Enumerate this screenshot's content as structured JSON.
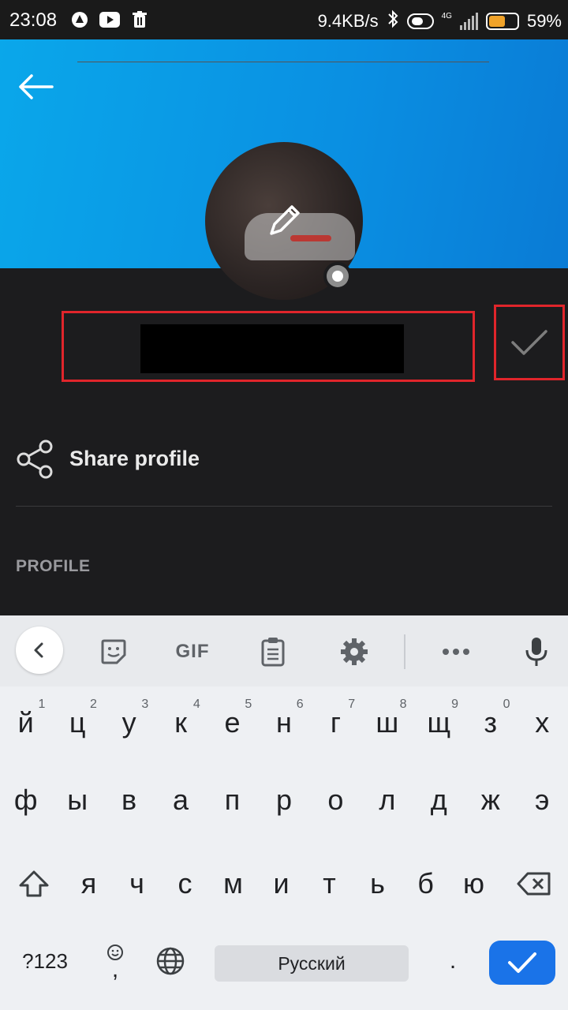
{
  "status_bar": {
    "time": "23:08",
    "net_speed": "9.4KB/s",
    "network_type": "4G",
    "battery": "59%",
    "battery_level": 0.59
  },
  "profile": {
    "name_value": "",
    "share_label": "Share profile",
    "section_title": "PROFILE"
  },
  "keyboard": {
    "toolbar": {
      "gif_label": "GIF"
    },
    "row1": [
      {
        "label": "й",
        "hint": "1"
      },
      {
        "label": "ц",
        "hint": "2"
      },
      {
        "label": "у",
        "hint": "3"
      },
      {
        "label": "к",
        "hint": "4"
      },
      {
        "label": "е",
        "hint": "5"
      },
      {
        "label": "н",
        "hint": "6"
      },
      {
        "label": "г",
        "hint": "7"
      },
      {
        "label": "ш",
        "hint": "8"
      },
      {
        "label": "щ",
        "hint": "9"
      },
      {
        "label": "з",
        "hint": "0"
      },
      {
        "label": "х",
        "hint": ""
      }
    ],
    "row2": [
      "ф",
      "ы",
      "в",
      "а",
      "п",
      "р",
      "о",
      "л",
      "д",
      "ж",
      "э"
    ],
    "row3": [
      "я",
      "ч",
      "с",
      "м",
      "и",
      "т",
      "ь",
      "б",
      "ю"
    ],
    "bottom": {
      "symbols_label": "?123",
      "comma_label": ",",
      "space_label": "Русский",
      "period_label": "."
    }
  },
  "colors": {
    "header_blue": "#0a9be6",
    "highlight_red": "#e0252b",
    "enter_blue": "#1a73e8"
  }
}
